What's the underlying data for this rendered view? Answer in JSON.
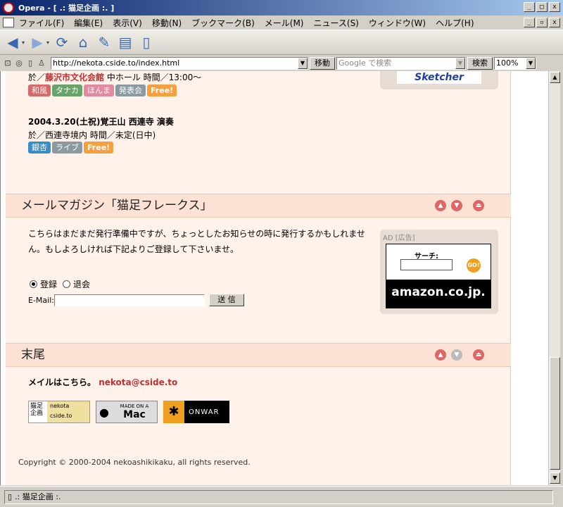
{
  "window": {
    "title": "Opera - [ .: 猫足企画 :. ]",
    "minimize": "_",
    "maximize": "□",
    "close": "x"
  },
  "menu": [
    "ファイル(F)",
    "編集(E)",
    "表示(V)",
    "移動(N)",
    "ブックマーク(B)",
    "メール(M)",
    "ニュース(S)",
    "ウィンドウ(W)",
    "ヘルプ(H)"
  ],
  "toolbar": {
    "back_icon": "back-arrow-icon",
    "forward_icon": "forward-arrow-icon",
    "reload_icon": "reload-icon",
    "home_icon": "home-icon"
  },
  "address": {
    "url": "http://nekota.cside.to/index.html",
    "go_label": "移動",
    "search_placeholder": "Google で検索",
    "search_label": "検索",
    "zoom": "100%"
  },
  "events": {
    "prev_venue_prefix": "於／",
    "prev_venue": "藤沢市文化会館",
    "prev_venue_rest": " 中ホール  時間／13:00～",
    "prev_tags": [
      "和風",
      "タナカ",
      "ほんま",
      "発表会",
      "Free!"
    ],
    "event2_title": "2004.3.20(土祝)覚王山 西連寺 演奏",
    "event2_info": "於／西連寺境内  時間／未定(日中)",
    "event2_tags": [
      "銀杏",
      "ライブ",
      "Free!"
    ]
  },
  "sketcher_banner": "Sketcher",
  "mailmag": {
    "heading": "メールマガジン「猫足フレークス」",
    "body": "こちらはまだまだ発行準備中ですが、ちょっとしたお知らせの時に発行するかもしれません。もしよろしければ下記よりご登録して下さいませ。",
    "radio_subscribe": "登録",
    "radio_unsubscribe": "退会",
    "email_label": "E-Mail:",
    "email_value": "",
    "submit_label": "送 信"
  },
  "ad": {
    "label": "AD [広告]",
    "search_label": "サーチ:",
    "go": "GO!",
    "brand": "amazon.co.jp."
  },
  "footer": {
    "heading": "末尾",
    "mail_label": "メイルはこちら。",
    "mail_address": "nekota@cside.to",
    "badge_site": "nekota cside.to",
    "badge_site_jp": "猫足企画",
    "badge_mac_top": "MADE ON A",
    "badge_mac": "Mac",
    "badge_onwar": "ONWAR",
    "copyright": "Copyright © 2000-2004 nekoashikikaku, all rights reserved."
  },
  "status": {
    "text": ".: 猫足企画 :."
  }
}
